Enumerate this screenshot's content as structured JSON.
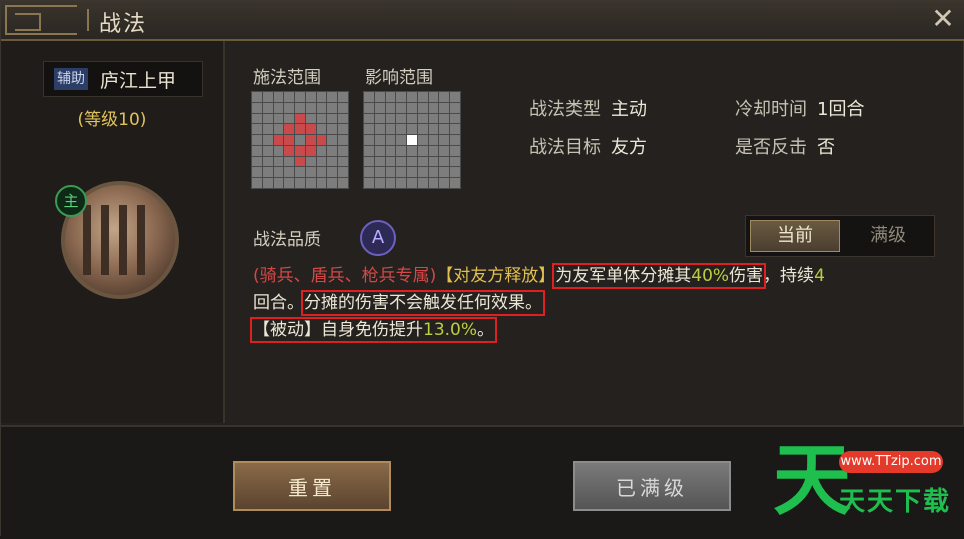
{
  "window": {
    "title": "战法",
    "close_icon": "close-icon"
  },
  "general": {
    "role": "辅助",
    "name": "庐江上甲",
    "level": "(等级10)",
    "main_badge": "主"
  },
  "ranges": {
    "cast_label": "施法范围",
    "effect_label": "影响范围"
  },
  "info": {
    "type_key": "战法类型",
    "type_val": "主动",
    "target_key": "战法目标",
    "target_val": "友方",
    "cooldown_key": "冷却时间",
    "cooldown_val": "1回合",
    "counter_key": "是否反击",
    "counter_val": "否"
  },
  "quality": {
    "label": "战法品质",
    "grade": "A"
  },
  "tabs": {
    "current": "当前",
    "max": "满级"
  },
  "description": {
    "p1": "(骑兵、盾兵、枪兵专属)",
    "p2": "【对友方释放】",
    "p3": "为友军单体分摊其",
    "p4": "40%",
    "p5": "伤害",
    "p6": "，持续",
    "p7": "4",
    "p8": "回合。",
    "p9": "分摊的伤害不会触发任何效果。",
    "p10": "【被动】自身免伤提升",
    "p11": "13.0%",
    "p12": "。"
  },
  "buttons": {
    "reset": "重置",
    "maxed": "已满级"
  },
  "watermark": {
    "big": "天",
    "url": "www.TTzip.com",
    "name": "天天下载"
  }
}
